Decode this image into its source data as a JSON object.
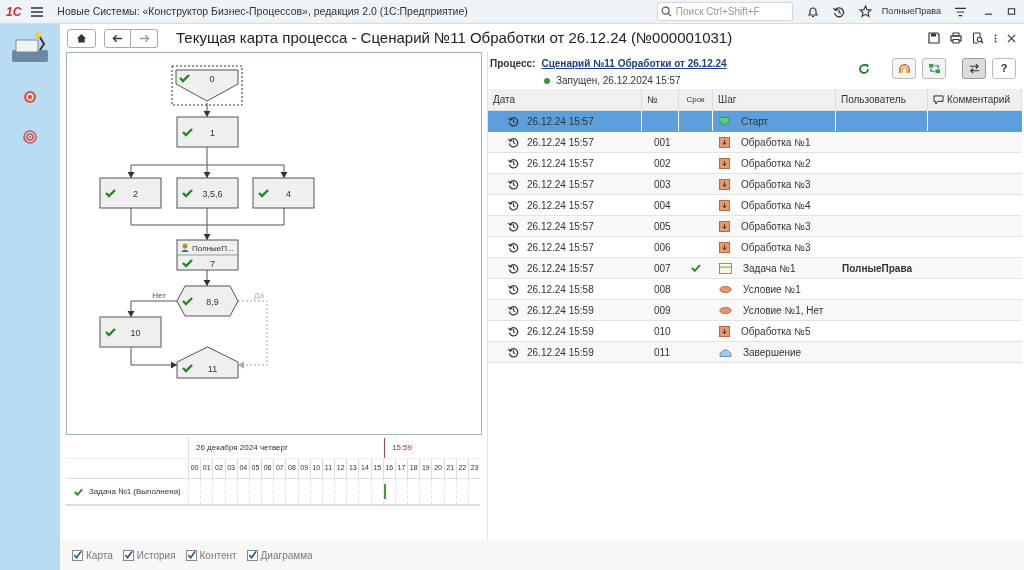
{
  "app_bar": {
    "logo": "1С",
    "title": "Новые Системы: «Конструктор Бизнес-Процессов», редакция 2.0  (1С:Предприятие)",
    "search": {
      "placeholder": "Поиск Ctrl+Shift+F"
    },
    "user": "ПолныеПрава"
  },
  "form": {
    "title": "Текущая карта процесса - Сценарий №11 Обработки от 26.12.24 (№000001031)"
  },
  "diagram": {
    "nodes": [
      {
        "label": "0",
        "kind": "start",
        "done": true,
        "selected": true
      },
      {
        "label": "1",
        "kind": "process",
        "done": true,
        "selected": false
      },
      {
        "label": "2",
        "kind": "process",
        "done": true,
        "selected": false
      },
      {
        "label": "3,5,6",
        "kind": "process",
        "done": true,
        "selected": false
      },
      {
        "label": "4",
        "kind": "process",
        "done": true,
        "selected": false
      },
      {
        "label": "7",
        "kind": "task",
        "user": "ПолныеП...",
        "done": true,
        "selected": false
      },
      {
        "label": "8,9",
        "kind": "condition",
        "done": true,
        "selected": false
      },
      {
        "label": "10",
        "kind": "process",
        "done": true,
        "selected": false
      },
      {
        "label": "11",
        "kind": "end",
        "done": true,
        "selected": false
      }
    ],
    "branch_no": "Нет",
    "branch_yes": "Да"
  },
  "timeline": {
    "date": "26 декабря 2024 четверг",
    "time": "15:59",
    "hours": [
      "00",
      "01",
      "02",
      "03",
      "04",
      "05",
      "06",
      "07",
      "08",
      "09",
      "10",
      "11",
      "12",
      "13",
      "14",
      "15",
      "16",
      "17",
      "18",
      "19",
      "20",
      "21",
      "22",
      "23"
    ],
    "tasks": [
      {
        "label": "Задача №1 (Выполнена)",
        "done": true
      }
    ]
  },
  "process": {
    "label": "Процесс:",
    "link": "Сценарий №11 Обработки от 26.12.24",
    "status": "Запущен, 26.12.2024 15:57",
    "color": "#2ea02e",
    "help": "?"
  },
  "table": {
    "columns": [
      "Дата",
      "№",
      "Срок",
      "Шаг",
      "Пользователь",
      "Комментарий"
    ],
    "rows": [
      {
        "date": "26.12.24 15:57",
        "number": "",
        "on_time": false,
        "step": "Старт",
        "kind": "start",
        "user": "",
        "selected": true
      },
      {
        "date": "26.12.24 15:57",
        "number": "001",
        "on_time": false,
        "step": "Обработка №1",
        "kind": "process",
        "user": "",
        "selected": false
      },
      {
        "date": "26.12.24 15:57",
        "number": "002",
        "on_time": false,
        "step": "Обработка №2",
        "kind": "process",
        "user": "",
        "selected": false
      },
      {
        "date": "26.12.24 15:57",
        "number": "003",
        "on_time": false,
        "step": "Обработка №3",
        "kind": "process",
        "user": "",
        "selected": false
      },
      {
        "date": "26.12.24 15:57",
        "number": "004",
        "on_time": false,
        "step": "Обработка №4",
        "kind": "process",
        "user": "",
        "selected": false
      },
      {
        "date": "26.12.24 15:57",
        "number": "005",
        "on_time": false,
        "step": "Обработка №3",
        "kind": "process",
        "user": "",
        "selected": false
      },
      {
        "date": "26.12.24 15:57",
        "number": "006",
        "on_time": false,
        "step": "Обработка №3",
        "kind": "process",
        "user": "",
        "selected": false
      },
      {
        "date": "26.12.24 15:57",
        "number": "007",
        "on_time": true,
        "step": "Задача №1",
        "kind": "task",
        "user": "ПолныеПрава",
        "selected": false
      },
      {
        "date": "26.12.24 15:58",
        "number": "008",
        "on_time": false,
        "step": "Условие №1",
        "kind": "condition",
        "user": "",
        "selected": false
      },
      {
        "date": "26.12.24 15:59",
        "number": "009",
        "on_time": false,
        "step": "Условие №1, Нет",
        "kind": "condition",
        "user": "",
        "selected": false
      },
      {
        "date": "26.12.24 15:59",
        "number": "010",
        "on_time": false,
        "step": "Обработка №5",
        "kind": "process",
        "user": "",
        "selected": false
      },
      {
        "date": "26.12.24 15:59",
        "number": "011",
        "on_time": false,
        "step": "Завершение",
        "kind": "end",
        "user": "",
        "selected": false
      }
    ]
  },
  "view_options": [
    {
      "label": "Карта",
      "checked": true
    },
    {
      "label": "История",
      "checked": true
    },
    {
      "label": "Контент",
      "checked": true
    },
    {
      "label": "Диаграмма",
      "checked": true
    }
  ]
}
